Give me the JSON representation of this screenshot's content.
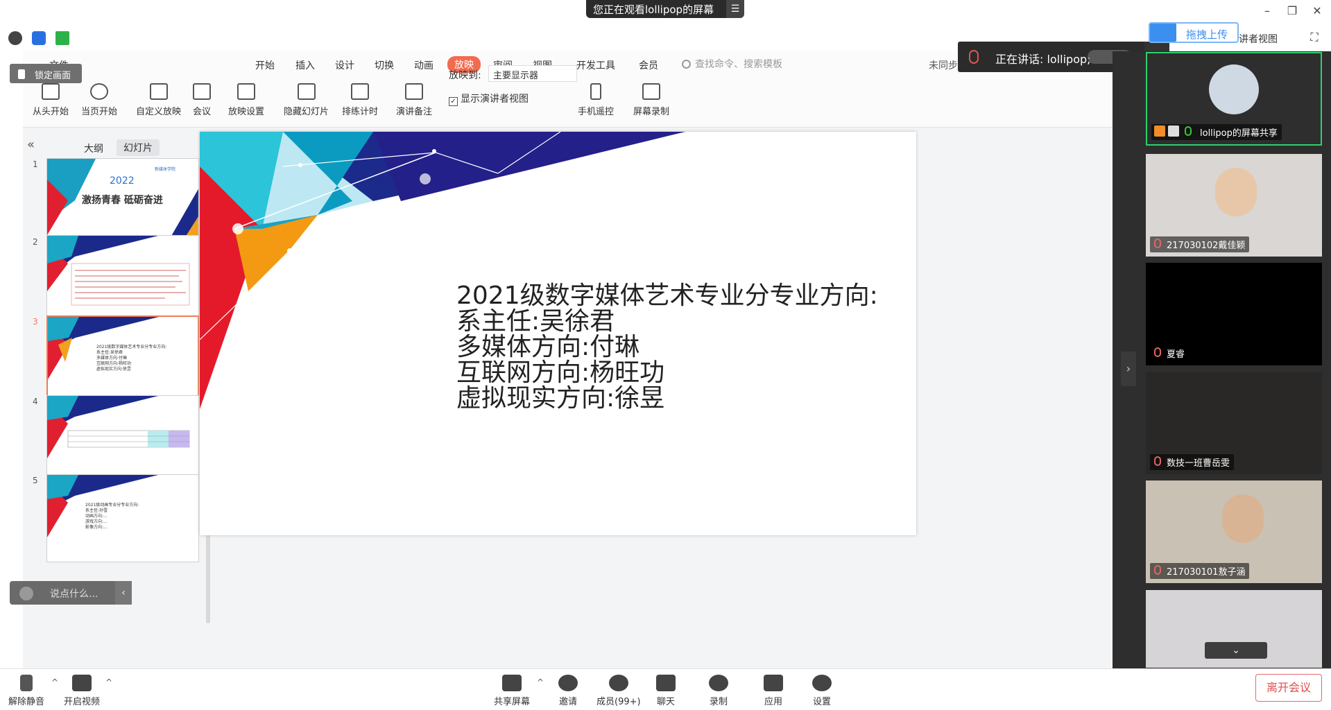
{
  "meeting": {
    "banner": "您正在观看lollipop的屏幕",
    "speaking": "正在讲话: lollipop;",
    "upload_label": "拖拽上传",
    "view_label": "讲者视图",
    "lock_label": "锁定画面",
    "chat_placeholder": "说点什么...",
    "leave_label": "离开会议"
  },
  "ppt": {
    "file_menu": "文件",
    "menu": [
      "开始",
      "插入",
      "设计",
      "切换",
      "动画",
      "放映",
      "审阅",
      "视图",
      "开发工具",
      "会员"
    ],
    "active_menu": "放映",
    "search_placeholder": "查找命令、搜索模板",
    "cloud_label": "未同步",
    "ribbon": [
      {
        "label": "从头开始",
        "icon": "play-from-start-icon"
      },
      {
        "label": "当页开始",
        "icon": "play-current-icon"
      },
      {
        "label": "自定义放映",
        "icon": "custom-show-icon"
      },
      {
        "label": "会议",
        "icon": "meeting-icon"
      },
      {
        "label": "放映设置",
        "icon": "show-settings-icon"
      },
      {
        "label": "隐藏幻灯片",
        "icon": "hide-slide-icon"
      },
      {
        "label": "排练计时",
        "icon": "rehearse-timing-icon"
      },
      {
        "label": "演讲备注",
        "icon": "speaker-notes-icon"
      },
      {
        "label": "手机遥控",
        "icon": "phone-remote-icon"
      },
      {
        "label": "屏幕录制",
        "icon": "screen-record-icon"
      }
    ],
    "show_to_label": "放映到:",
    "show_to_value": "主要显示器",
    "presenter_view_label": "显示演讲者视图",
    "tabs": {
      "outline": "大纲",
      "slides": "幻灯片"
    },
    "thumbnails": [
      {
        "num": "1",
        "year": "2022",
        "title": "激扬青春 砥砺奋进",
        "school": "新媒体学院"
      },
      {
        "num": "2"
      },
      {
        "num": "3",
        "lines": [
          "2021级数字媒体艺术专业分专业方向:",
          "系主任:吴徐君",
          "多媒体方向:付琳",
          "互联网方向:杨旺功",
          "虚拟现实方向:徐昱"
        ]
      },
      {
        "num": "4"
      },
      {
        "num": "5",
        "lines": [
          "2021级动画专业分专业方向:",
          "系主任:孙雪",
          "动画方向:...",
          "游戏方向:...",
          "影像方向:..."
        ]
      }
    ],
    "selected_slide": 3,
    "slide_lines": [
      "2021级数字媒体艺术专业分专业方向:",
      "系主任:吴徐君",
      "多媒体方向:付琳",
      "互联网方向:杨旺功",
      "虚拟现实方向:徐昱"
    ]
  },
  "participants": [
    {
      "name": "lollipop的屏幕共享",
      "active": true,
      "mic": "on"
    },
    {
      "name": "217030102戴佳颖",
      "mic": "muted"
    },
    {
      "name": "夏睿",
      "mic": "muted"
    },
    {
      "name": "数技一班曹岳雯",
      "mic": "muted"
    },
    {
      "name": "217030101敖子涵",
      "mic": "muted"
    }
  ],
  "toolbar": {
    "unmute": "解除静音",
    "video": "开启视频",
    "share": "共享屏幕",
    "invite": "邀请",
    "members": "成员(99+)",
    "chat": "聊天",
    "record": "录制",
    "apps": "应用",
    "settings": "设置"
  },
  "colors": {
    "accent": "#f26b4f",
    "active_border": "#2bd26b",
    "leave": "#e24b4b",
    "banner_bg": "#2b2b2b"
  }
}
